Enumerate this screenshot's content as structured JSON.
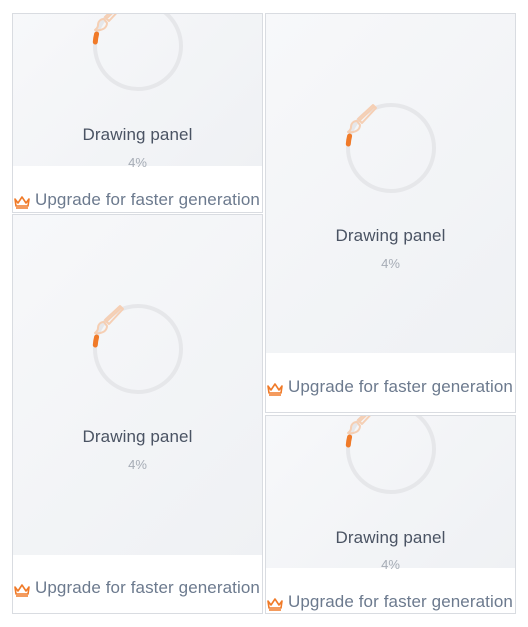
{
  "tiles": [
    {
      "title": "Drawing panel",
      "progress_text": "4%",
      "progress": 0.04,
      "upgrade_text": "Upgrade for faster generation"
    },
    {
      "title": "Drawing panel",
      "progress_text": "4%",
      "progress": 0.04,
      "upgrade_text": "Upgrade for faster generation"
    },
    {
      "title": "Drawing panel",
      "progress_text": "4%",
      "progress": 0.04,
      "upgrade_text": "Upgrade for faster generation"
    },
    {
      "title": "Drawing panel",
      "progress_text": "4%",
      "progress": 0.04,
      "upgrade_text": "Upgrade for faster generation"
    }
  ],
  "colors": {
    "accent": "#f07a28",
    "ring": "#e6e7ea",
    "brush": "#f5cfb4"
  },
  "icons": {
    "brush": "paintbrush-icon",
    "crown": "crown-icon"
  }
}
